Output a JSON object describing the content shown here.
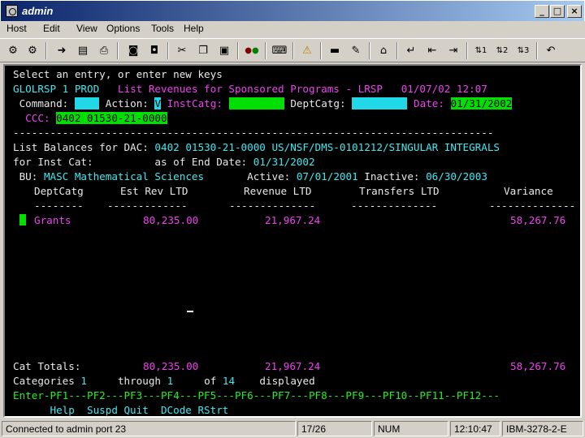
{
  "window": {
    "title": "admin",
    "minimize": "_",
    "maximize": "□",
    "close": "×"
  },
  "menu": [
    "Host",
    "Edit",
    "View",
    "Options",
    "Tools",
    "Help"
  ],
  "toolbar": {
    "icons": [
      "connect-icon",
      "disconnect-icon",
      "send-icon",
      "receive-icon",
      "print-icon",
      "save-icon",
      "export-icon",
      "cut-icon",
      "copy-icon",
      "paste-icon",
      "macro-icon",
      "keyboard-icon",
      "alert-icon",
      "display-icon",
      "pen-icon",
      "home-icon",
      "enter-icon",
      "tab-back-icon",
      "tab-forward-icon",
      "session-1-icon",
      "session-2-icon",
      "session-3-icon",
      "undo-icon"
    ]
  },
  "terminal": {
    "prompt": "Select an entry, or enter new keys",
    "screen_id": "GLOLRSP 1 PROD",
    "screen_title": "List Revenues for Sponsored Programs - LRSP",
    "screen_datetime": "01/07/02 12:07",
    "command_label": "Command:",
    "action_label": "Action:",
    "action_value": "V",
    "instcatg_label": "InstCatg:",
    "deptcatg_label": "DeptCatg:",
    "date_label": "Date:",
    "date_value": "01/31/2002",
    "ccc_label": "CCC:",
    "ccc_value": "0402 01530-21-0000",
    "divider": "------------------------------------------------------------------------------",
    "list_label": "List Balances for DAC:",
    "list_value": "0402 01530-21-0000 US/NSF/DMS-0101212/SINGULAR INTEGRALS",
    "inst_cat_label": "for Inst Cat:",
    "end_date_label": "as of End Date:",
    "end_date_value": "01/31/2002",
    "bu_label": "BU:",
    "bu_value": "MASC Mathematical Sciences",
    "active_label": "Active:",
    "active_value": "07/01/2001",
    "inactive_label": "Inactive:",
    "inactive_value": "06/30/2003",
    "columns": [
      "DeptCatg",
      "Est Rev LTD",
      "Revenue LTD",
      "Transfers LTD",
      "Variance"
    ],
    "col_underlines": [
      "--------",
      "-------------",
      "--------------",
      "--------------",
      "--------------"
    ],
    "rows": [
      {
        "deptcatg": "Grants",
        "est_rev": "80,235.00",
        "revenue": "21,967.24",
        "transfers": "",
        "variance": "58,267.76"
      }
    ],
    "totals_label": "Cat Totals:",
    "totals": {
      "est_rev": "80,235.00",
      "revenue": "21,967.24",
      "variance": "58,267.76"
    },
    "categories_label": "Categories",
    "categories_from": "1",
    "through_label": "through",
    "categories_to": "1",
    "of_label": "of",
    "categories_total": "14",
    "displayed_label": "displayed",
    "pf_line": "Enter-PF1---PF2---PF3---PF4---PF5---PF6---PF7---PF8---PF9---PF10--PF11--PF12---",
    "pf_labels": "      Help  Suspd Quit  DCode RStrt"
  },
  "status": {
    "connection": "Connected to admin port 23",
    "cursor_pos": "17/26",
    "num": "NUM",
    "time": "12:10:47",
    "terminal_type": "IBM-3278-2-E"
  },
  "colors": {
    "terminal_bg": "#000000",
    "turquoise": "#40e8f0",
    "magenta": "#f040f0",
    "green": "#20f020",
    "white": "#e8e8e8",
    "titlebar": "#0a246a"
  }
}
